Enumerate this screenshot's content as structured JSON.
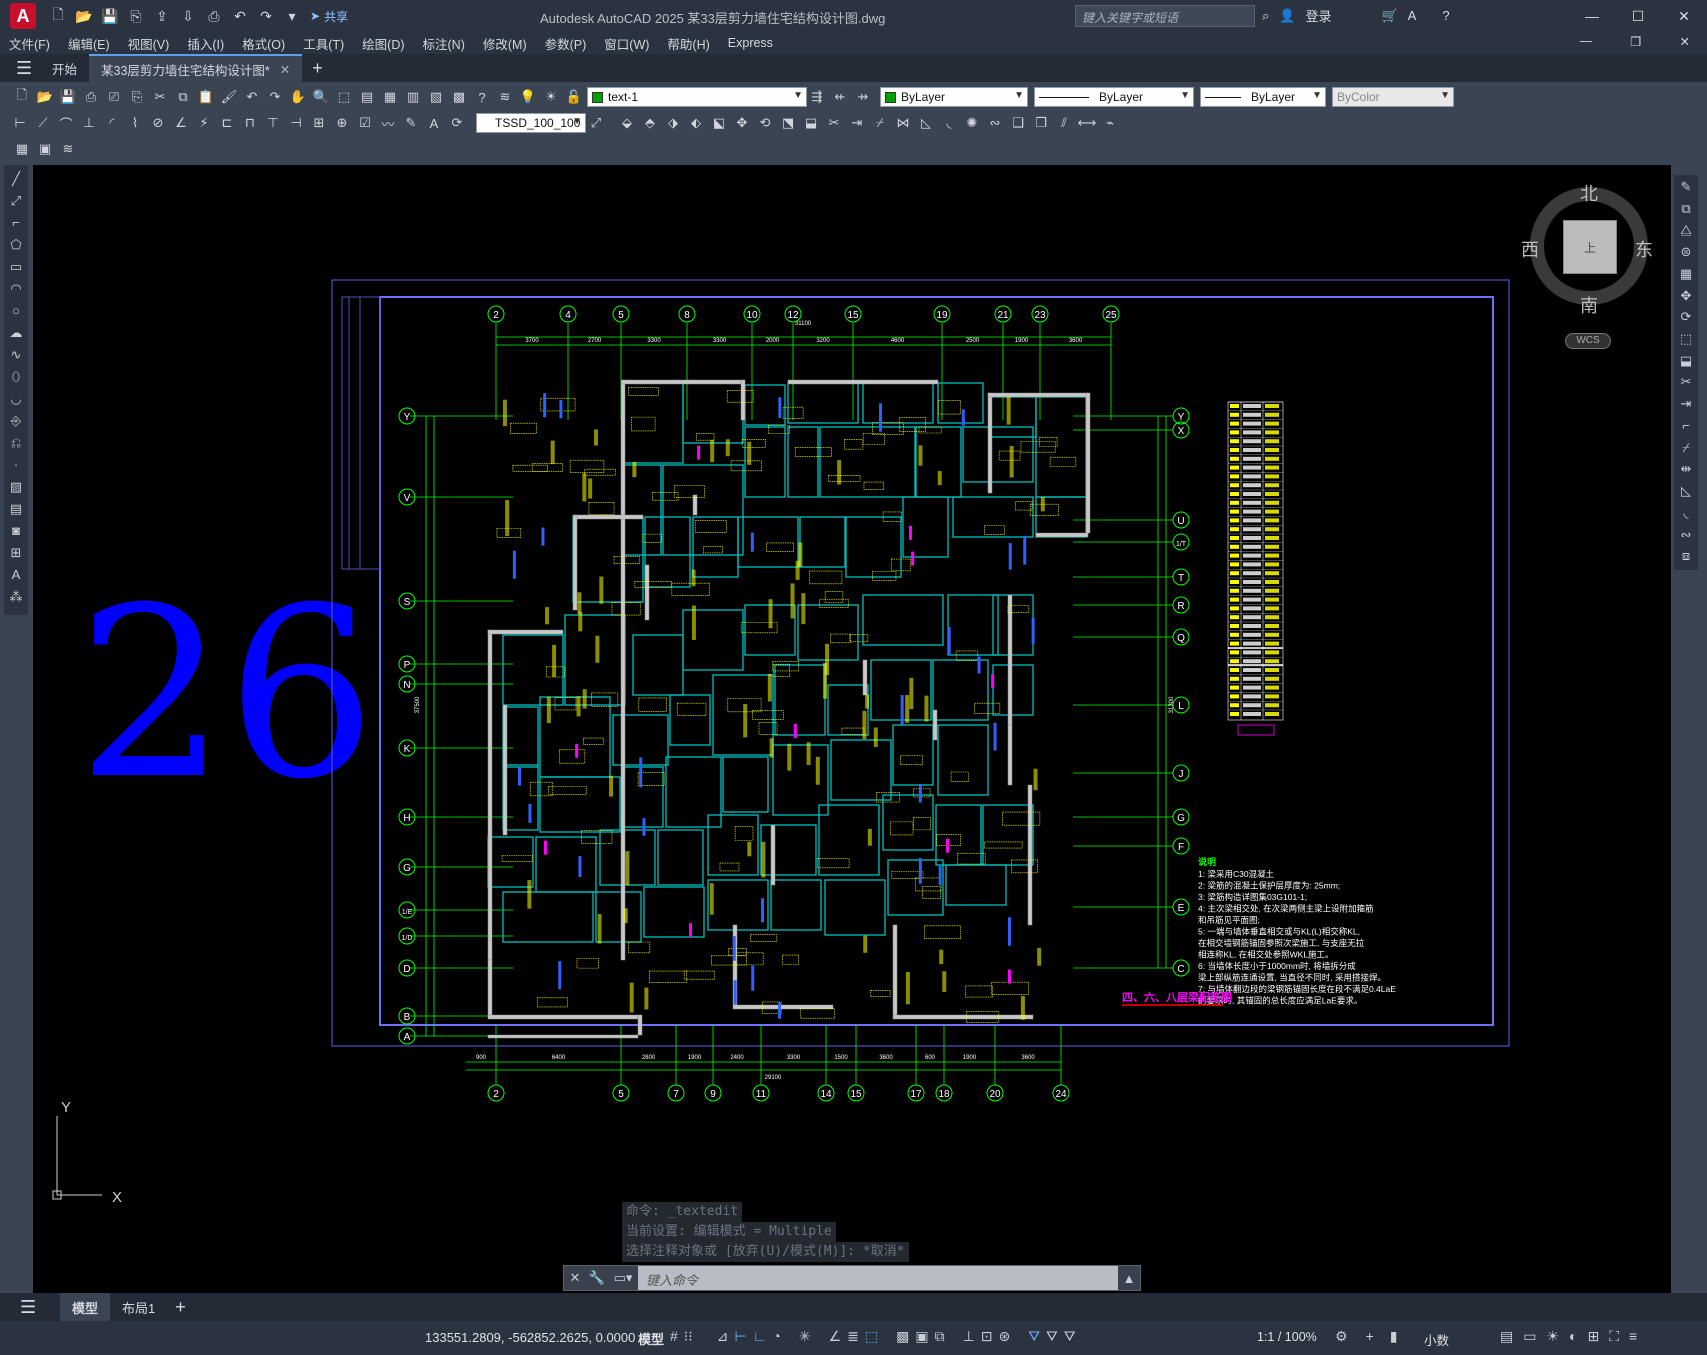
{
  "app": {
    "logo": "A",
    "window_title": "Autodesk AutoCAD 2025    某33层剪力墙住宅结构设计图.dwg",
    "share_label": "共享",
    "search_placeholder": "键入关键字或短语",
    "login_label": "登录"
  },
  "menu": [
    "文件(F)",
    "编辑(E)",
    "视图(V)",
    "插入(I)",
    "格式(O)",
    "工具(T)",
    "绘图(D)",
    "标注(N)",
    "修改(M)",
    "参数(P)",
    "窗口(W)",
    "帮助(H)",
    "Express"
  ],
  "tabs": {
    "start": "开始",
    "drawing": "某33层剪力墙住宅结构设计图*"
  },
  "properties": {
    "layer": "text-1",
    "color": "ByLayer",
    "linetype": "ByLayer",
    "lineweight": "ByLayer",
    "plotstyle": "ByColor",
    "dimstyle": "TSSD_100_100"
  },
  "viewcube": {
    "north": "北",
    "south": "南",
    "east": "东",
    "west": "西",
    "top": "上",
    "wcs": "WCS"
  },
  "drawing": {
    "big_number": "26",
    "drawing_title": "四、六、八层梁配筋图",
    "notes_title": "说明",
    "notes": [
      "1: 梁采用C30混凝土",
      "2: 梁筋的混凝土保护层厚度为: 25mm;",
      "3: 梁筋构造详图集03G101-1;",
      "4: 主次梁相交处, 在次梁两侧主梁上设附加箍筋",
      "   和吊筋见平面图;",
      "5: 一端与墙体垂直相交或与KL(L)相交称KL,",
      "   在相交墙钢筋锚固参照次梁施工, 与支座无拉",
      "   相连称KL, 在相交处参照WKL施工。",
      "6: 当墙体长度小于1000mm时, 将墙拆分成",
      "   梁上部纵筋连通设置, 当直径不同时, 采用搭接焊。",
      "7: 与墙体翻边段的梁钢筋锚固长度在段不满足0.4LaE",
      "   的要求时, 其锚固的总长度应满足LaE要求。"
    ],
    "top_axes": [
      "2",
      "4",
      "5",
      "8",
      "10",
      "12",
      "15",
      "19",
      "21",
      "23",
      "25"
    ],
    "bottom_axes": [
      "2",
      "5",
      "7",
      "9",
      "11",
      "14",
      "15",
      "17",
      "18",
      "20",
      "24"
    ],
    "left_axes": [
      "Y",
      "V",
      "S",
      "P",
      "N",
      "K",
      "H",
      "G",
      "1/E",
      "1/D",
      "D",
      "B",
      "A"
    ],
    "right_axes": [
      "Y",
      "X",
      "U",
      "1/T",
      "T",
      "R",
      "Q",
      "L",
      "J",
      "G",
      "F",
      "E",
      "C"
    ],
    "top_dims": [
      "3700",
      "2700",
      "3300",
      "3300",
      "2000",
      "3200",
      "4600",
      "2500",
      "1900",
      "3600"
    ],
    "top_total": "31100",
    "bottom_dims": [
      "900",
      "6400",
      "2800",
      "1900",
      "2400",
      "3300",
      "1500",
      "3600",
      "600",
      "1900",
      "3600"
    ],
    "bottom_total": "29100",
    "left_total": "37500",
    "right_total": "31300"
  },
  "command": {
    "history": [
      "命令: _textedit",
      "当前设置: 编辑模式 = Multiple",
      "选择注释对象或 [放弃(U)/模式(M)]: *取消*"
    ],
    "placeholder": "键入命令"
  },
  "layout_tabs": [
    "模型",
    "布局1"
  ],
  "status": {
    "coords": "133551.2809, -562852.2625, 0.0000",
    "mode": "模型",
    "scale": "1:1 / 100%",
    "units": "小数"
  },
  "colors": {
    "canvas": "#000000",
    "ui_dark": "#2b3340",
    "big_number": "#0000ff",
    "axis_line": "#00ff00",
    "walls": "#c0c0c0",
    "beams": "#00c0c0",
    "beam_text": "#ffff00",
    "frame": "#6060ff",
    "title_text": "#ff00ff",
    "notes_text": "#ffffff"
  }
}
